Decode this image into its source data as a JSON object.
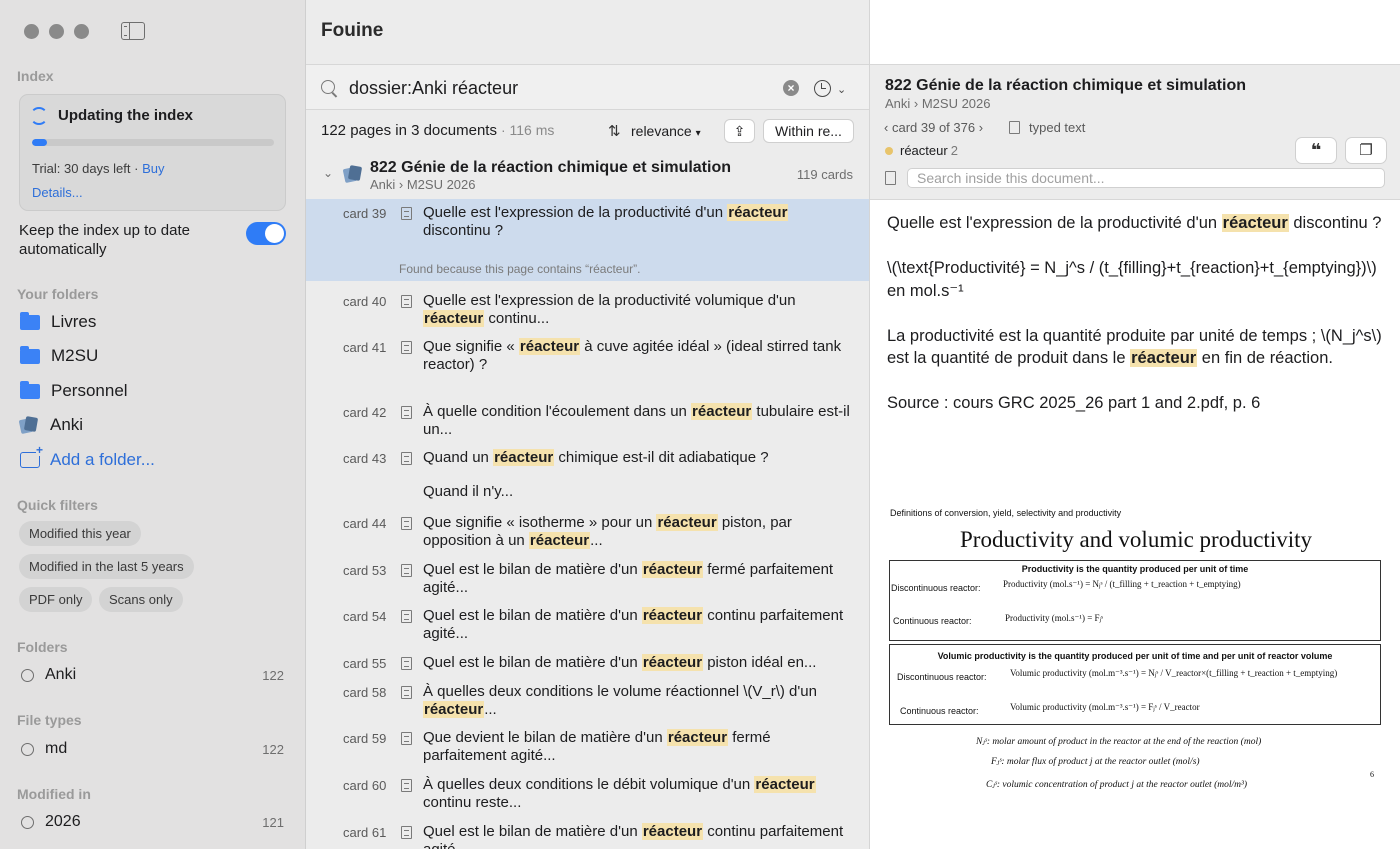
{
  "app": {
    "title": "Fouine"
  },
  "sidebar": {
    "index_label": "Index",
    "updating": "Updating the index",
    "progress": 0.06,
    "trial": "Trial: 30 days left",
    "separator": "·",
    "buy": "Buy",
    "details": "Details...",
    "keep_label": "Keep the index up to date automatically",
    "keep_on": true,
    "your_folders_label": "Your folders",
    "folders": [
      "Livres",
      "M2SU",
      "Personnel",
      "Anki"
    ],
    "add_folder": "Add a folder...",
    "quick_filters_label": "Quick filters",
    "quick_filters": [
      "Modified this year",
      "Modified in the last 5 years",
      "PDF only",
      "Scans only"
    ],
    "folders_label": "Folders",
    "folder_filter": {
      "name": "Anki",
      "count": "122"
    },
    "file_types_label": "File types",
    "file_type": {
      "name": "md",
      "count": "122"
    },
    "modified_label": "Modified in",
    "modified": {
      "name": "2026",
      "count": "121"
    }
  },
  "search": {
    "query": "dossier:Anki réacteur"
  },
  "results": {
    "summary": "122 pages in 3 documents",
    "time": "· 116 ms",
    "sort": "relevance",
    "within": "Within re...",
    "doc_title": "822 Génie de la réaction chimique et simulation",
    "doc_path": "Anki › M2SU 2026",
    "doc_count": "119 cards",
    "found_note": "Found because this page contains “réacteur”.",
    "rows": [
      {
        "card": "card 39",
        "pre": "Quelle est l'expression de la productivité d'un ",
        "hit": "réacteur",
        "post": " discontinu ?"
      },
      {
        "card": "card 40",
        "pre": "Quelle est l'expression de la productivité volumique d'un ",
        "hit": "réacteur",
        "post": " continu..."
      },
      {
        "card": "card 41",
        "pre": "Que signifie « ",
        "hit": "réacteur",
        "post": " à cuve agitée idéal » (ideal stirred tank reactor) ?"
      },
      {
        "card": "card 42",
        "pre": "À quelle condition l'écoulement dans un ",
        "hit": "réacteur",
        "post": " tubulaire est-il un..."
      },
      {
        "card": "card 43",
        "pre": "Quand un ",
        "hit": "réacteur",
        "post": " chimique est-il dit adiabatique ?",
        "extra": "Quand il n'y..."
      },
      {
        "card": "card 44",
        "pre": "Que signifie « isotherme » pour un ",
        "hit": "réacteur",
        "post": " piston, par opposition à un ",
        "hit2": "réacteur",
        "post2": "..."
      },
      {
        "card": "card 53",
        "pre": "Quel est le bilan de matière d'un ",
        "hit": "réacteur",
        "post": " fermé parfaitement agité..."
      },
      {
        "card": "card 54",
        "pre": "Quel est le bilan de matière d'un ",
        "hit": "réacteur",
        "post": " continu parfaitement agité..."
      },
      {
        "card": "card 55",
        "pre": "Quel est le bilan de matière d'un ",
        "hit": "réacteur",
        "post": " piston idéal en..."
      },
      {
        "card": "card 58",
        "pre": "À quelles deux conditions le volume réactionnel \\(V_r\\) d'un ",
        "hit": "réacteur",
        "post": "..."
      },
      {
        "card": "card 59",
        "pre": "Que devient le bilan de matière d'un ",
        "hit": "réacteur",
        "post": " fermé parfaitement agité..."
      },
      {
        "card": "card 60",
        "pre": "À quelles deux conditions le débit volumique d'un ",
        "hit": "réacteur",
        "post": " continu reste..."
      },
      {
        "card": "card 61",
        "pre": "Quel est le bilan de matière d'un ",
        "hit": "réacteur",
        "post": " continu parfaitement agité..."
      }
    ]
  },
  "preview": {
    "title": "822 Génie de la réaction chimique et simulation",
    "path": "Anki › M2SU 2026",
    "nav": "card 39 of 376",
    "type": "typed text",
    "tag": "réacteur",
    "tag_count": "2",
    "search_placeholder": "Search inside this document...",
    "p1_pre": "Quelle est l'expression de la productivité d'un ",
    "p1_hit": "réacteur",
    "p1_post": " discontinu ?",
    "p2": "\\(\\text{Productivité} = N_j^s / (t_{filling}+t_{reaction}+t_{emptying})\\) en mol.s⁻¹",
    "p3_pre": "La productivité est la quantité produite par unité de temps ; \\(N_j^s\\) est la quantité de produit dans le ",
    "p3_hit": "réacteur",
    "p3_post": " en fin de réaction.",
    "p4": "Source : cours GRC 2025_26 part 1 and 2.pdf, p. 6",
    "slide": {
      "small": "Definitions of conversion, yield, selectivity and productivity",
      "heading": "Productivity and volumic productivity",
      "box1_title": "Productivity is the quantity produced per unit of time",
      "disc": "Discontinuous reactor:",
      "cont": "Continuous reactor:",
      "f1": "Productivity (mol.s⁻¹) = Nⱼˢ / (t_filling + t_reaction + t_emptying)",
      "f2": "Productivity (mol.s⁻¹) = Fⱼˢ",
      "box2_title": "Volumic productivity is the quantity produced per unit of time and per unit of reactor volume",
      "f3": "Volumic productivity (mol.m⁻³.s⁻¹) = Nⱼˢ / V_reactor×(t_filling + t_reaction + t_emptying)",
      "f4": "Volumic productivity (mol.m⁻³.s⁻¹) = Fⱼˢ / V_reactor",
      "d1": "Nⱼˢ: molar amount of product in the reactor at the end of the reaction (mol)",
      "d2": "Fⱼˢ: molar flux of product j at the reactor outlet (mol/s)",
      "d3": "Cⱼˢ: volumic concentration of product j at the reactor outlet (mol/m³)",
      "page": "6"
    }
  },
  "colors": {
    "accent": "#2f7cf6",
    "highlight": "#f5e2ad",
    "selected_row": "#cddbed"
  }
}
